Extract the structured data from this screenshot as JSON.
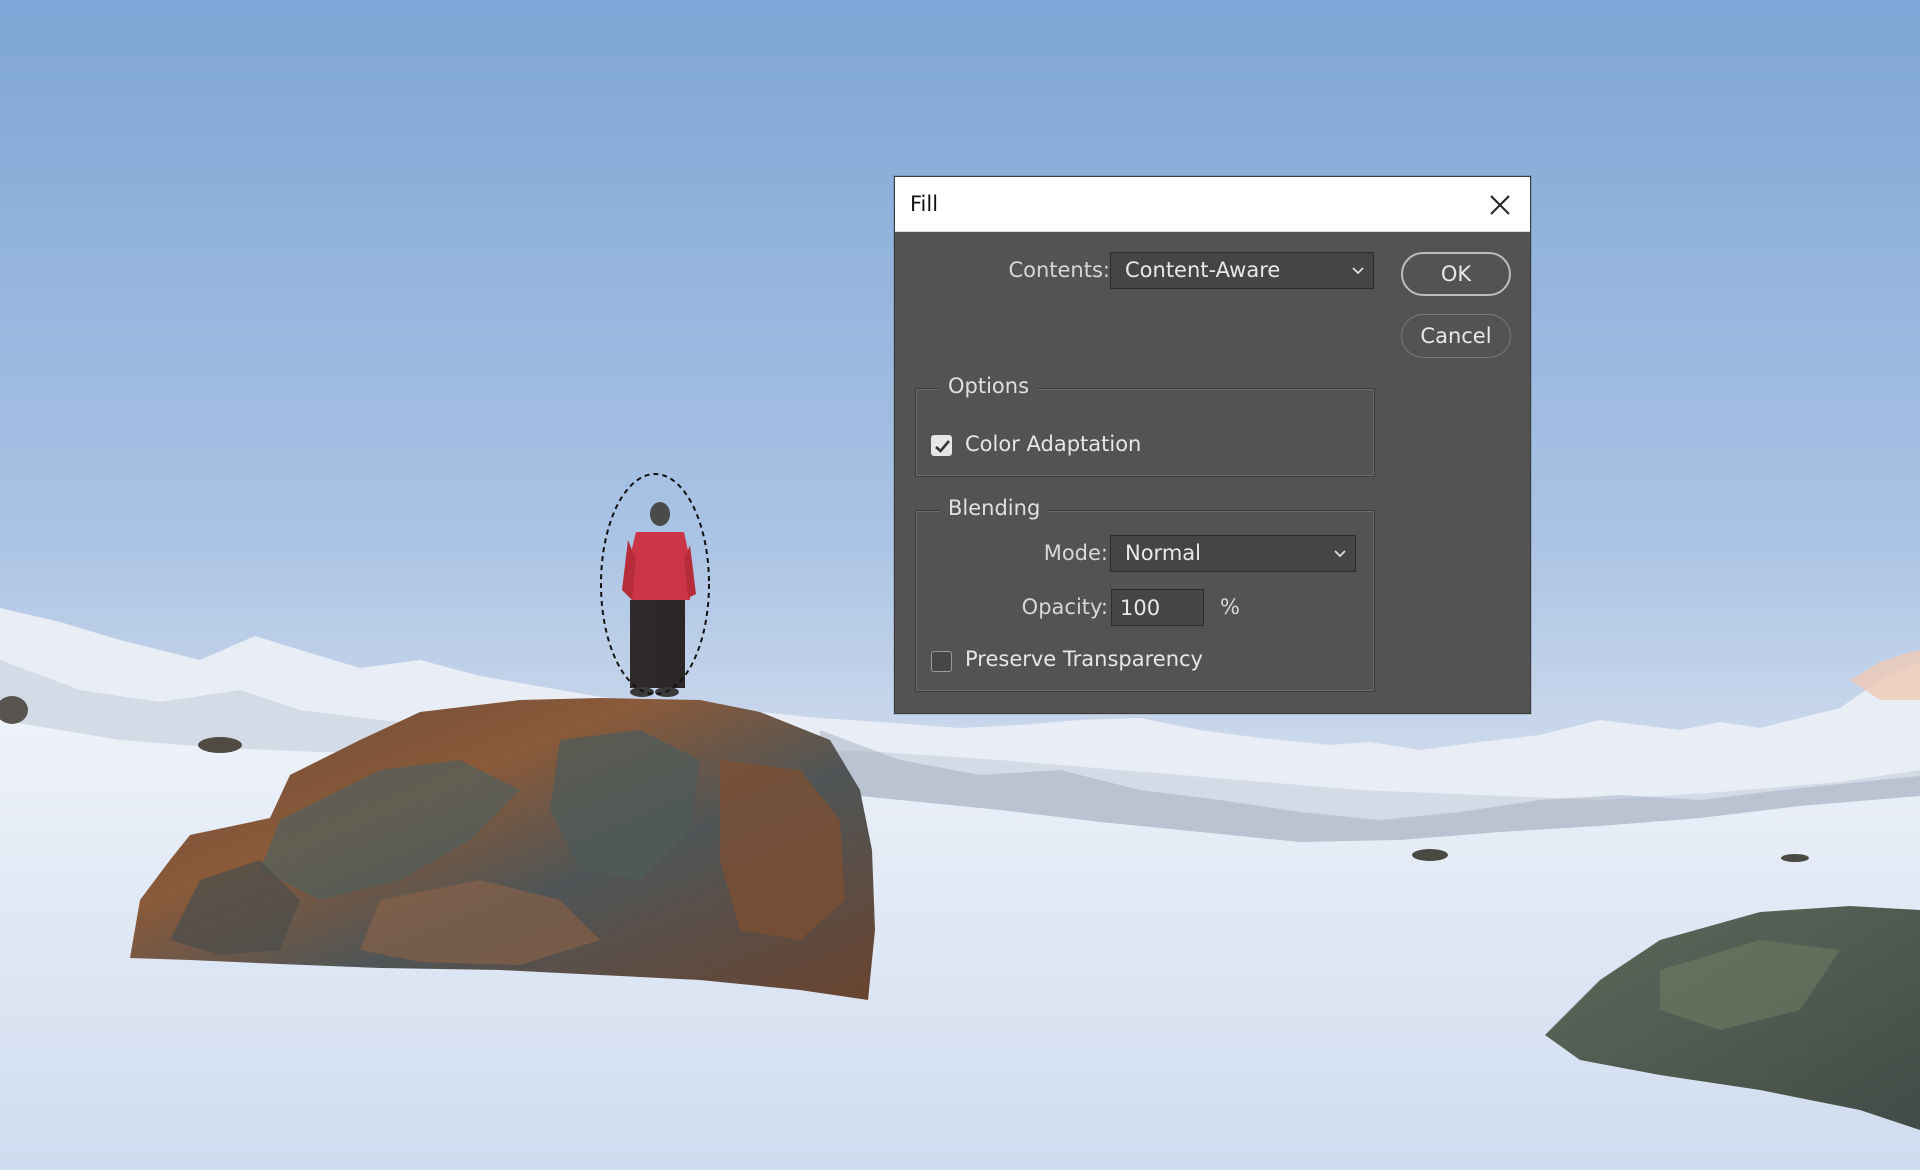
{
  "dialog": {
    "title": "Fill",
    "contents_label": "Contents:",
    "contents_value": "Content-Aware",
    "ok_label": "OK",
    "cancel_label": "Cancel",
    "options": {
      "legend": "Options",
      "color_adaptation_label": "Color Adaptation",
      "color_adaptation_checked": true
    },
    "blending": {
      "legend": "Blending",
      "mode_label": "Mode:",
      "mode_value": "Normal",
      "opacity_label": "Opacity:",
      "opacity_value": "100",
      "opacity_unit": "%",
      "preserve_transparency_label": "Preserve Transparency",
      "preserve_transparency_checked": false
    }
  },
  "icons": {
    "close": "close-icon",
    "chevron": "chevron-down-icon",
    "check": "checkmark-icon"
  },
  "colors": {
    "sky_top": "#7fa7d6",
    "sky_bottom": "#dfe6f3",
    "snow": "#e3ebf6",
    "dialog_bg": "#535353",
    "jacket": "#cc3545"
  }
}
